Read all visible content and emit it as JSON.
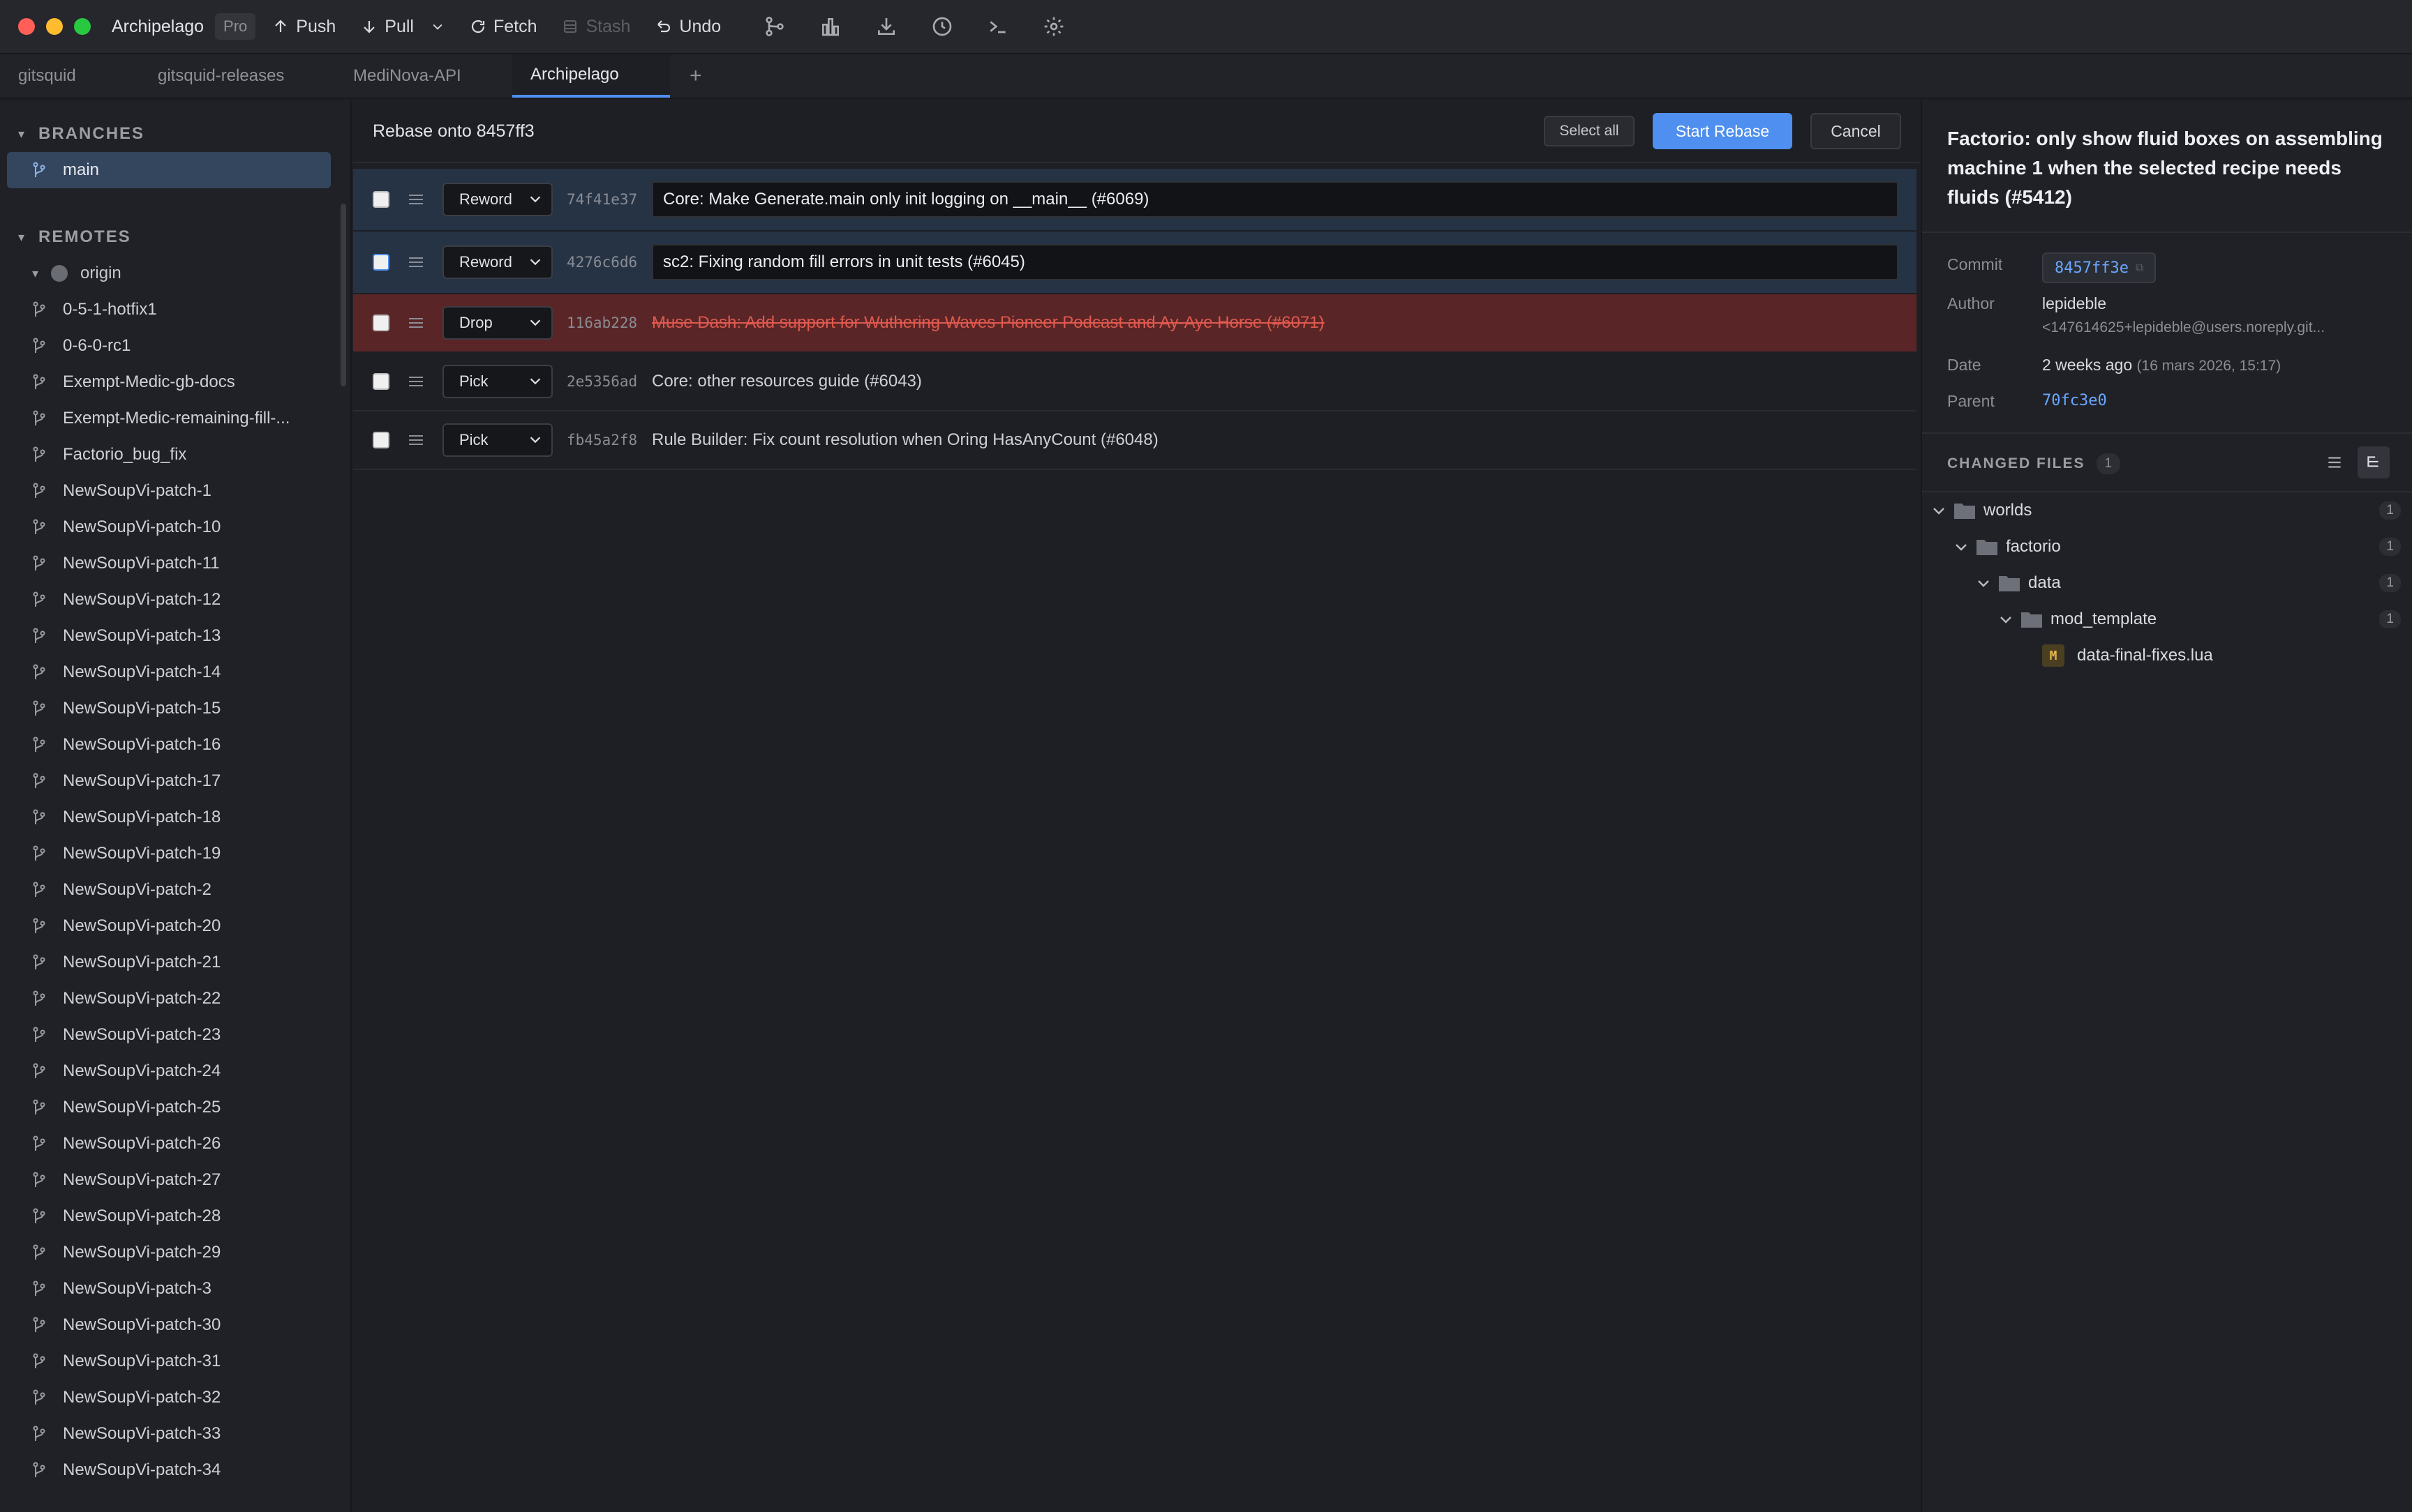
{
  "toolbar": {
    "app_title": "Archipelago",
    "pro_badge": "Pro",
    "push": "Push",
    "pull": "Pull",
    "fetch": "Fetch",
    "stash": "Stash",
    "undo": "Undo",
    "icons": [
      "branch-icon",
      "chart-icon",
      "download-icon",
      "history-icon",
      "terminal-icon",
      "settings-icon"
    ],
    "traffic_colors": [
      "#ff5f57",
      "#febc2e",
      "#28c840"
    ]
  },
  "tabs": [
    {
      "label": "gitsquid",
      "active": false
    },
    {
      "label": "gitsquid-releases",
      "active": false
    },
    {
      "label": "MediNova-API",
      "active": false
    },
    {
      "label": "Archipelago",
      "active": true
    }
  ],
  "tab_add": "+",
  "sidebar": {
    "branches_heading": "BRANCHES",
    "current_branch": "main",
    "remotes_heading": "REMOTES",
    "remote_name": "origin",
    "remote_branches": [
      "0-5-1-hotfix1",
      "0-6-0-rc1",
      "Exempt-Medic-gb-docs",
      "Exempt-Medic-remaining-fill-...",
      "Factorio_bug_fix",
      "NewSoupVi-patch-1",
      "NewSoupVi-patch-10",
      "NewSoupVi-patch-11",
      "NewSoupVi-patch-12",
      "NewSoupVi-patch-13",
      "NewSoupVi-patch-14",
      "NewSoupVi-patch-15",
      "NewSoupVi-patch-16",
      "NewSoupVi-patch-17",
      "NewSoupVi-patch-18",
      "NewSoupVi-patch-19",
      "NewSoupVi-patch-2",
      "NewSoupVi-patch-20",
      "NewSoupVi-patch-21",
      "NewSoupVi-patch-22",
      "NewSoupVi-patch-23",
      "NewSoupVi-patch-24",
      "NewSoupVi-patch-25",
      "NewSoupVi-patch-26",
      "NewSoupVi-patch-27",
      "NewSoupVi-patch-28",
      "NewSoupVi-patch-29",
      "NewSoupVi-patch-3",
      "NewSoupVi-patch-30",
      "NewSoupVi-patch-31",
      "NewSoupVi-patch-32",
      "NewSoupVi-patch-33",
      "NewSoupVi-patch-34"
    ]
  },
  "rebase": {
    "title": "Rebase onto 8457ff3",
    "select_all": "Select all",
    "start": "Start Rebase",
    "cancel": "Cancel",
    "commits": [
      {
        "action": "Reword",
        "hash": "74f41e37",
        "message": "Core: Make Generate.main only init logging on __main__ (#6069)"
      },
      {
        "action": "Reword",
        "hash": "4276c6d6",
        "message": "sc2: Fixing random fill errors in unit tests (#6045)"
      },
      {
        "action": "Drop",
        "hash": "116ab228",
        "message": "Muse Dash: Add support for Wuthering Waves Pioneer Podcast and Ay-Aye Horse (#6071)"
      },
      {
        "action": "Pick",
        "hash": "2e5356ad",
        "message": "Core: other resources guide (#6043)"
      },
      {
        "action": "Pick",
        "hash": "fb45a2f8",
        "message": "Rule Builder: Fix count resolution when Oring HasAnyCount (#6048)"
      }
    ]
  },
  "details": {
    "title": "Factorio: only show fluid boxes on assembling machine 1 when the selected recipe needs fluids (#5412)",
    "commit_label": "Commit",
    "commit_hash": "8457ff3e",
    "author_label": "Author",
    "author_name": "lepideble",
    "author_email": "<147614625+lepideble@users.noreply.git...",
    "date_label": "Date",
    "date_relative": "2 weeks ago",
    "date_full": "(16 mars 2026, 15:17)",
    "parent_label": "Parent",
    "parent_hash": "70fc3e0",
    "changed_files_heading": "CHANGED FILES",
    "changed_files_count": "1",
    "tree": [
      {
        "name": "worlds",
        "count": "1"
      },
      {
        "name": "factorio",
        "count": "1"
      },
      {
        "name": "data",
        "count": "1"
      },
      {
        "name": "mod_template",
        "count": "1"
      }
    ],
    "file": {
      "status": "M",
      "name": "data-final-fixes.lua"
    }
  }
}
